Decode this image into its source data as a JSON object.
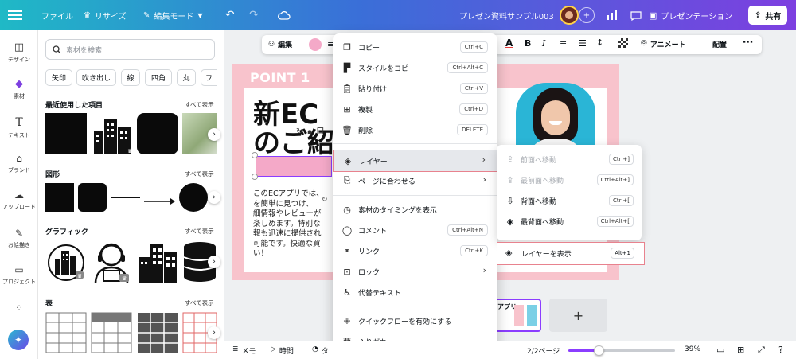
{
  "topbar": {
    "file": "ファイル",
    "resize": "リサイズ",
    "edit_mode": "編集モード",
    "doc_title": "プレゼン資料サンプル003",
    "present": "プレゼンテーション",
    "share": "共有"
  },
  "leftnav": [
    "デザイン",
    "素材",
    "テキスト",
    "ブランド",
    "アップロード",
    "お絵描き",
    "プロジェクト"
  ],
  "panel": {
    "search_placeholder": "素材を検索",
    "chips": [
      "矢印",
      "吹き出し",
      "線",
      "四角",
      "丸",
      "フ"
    ],
    "sections": [
      {
        "title": "最近使用した項目",
        "link": "すべて表示"
      },
      {
        "title": "図形",
        "link": "すべて表示"
      },
      {
        "title": "グラフィック",
        "link": "すべて表示"
      },
      {
        "title": "表",
        "link": "すべて表示"
      }
    ]
  },
  "toolbar": {
    "edit": "編集",
    "animate": "アニメート",
    "position": "配置"
  },
  "slide": {
    "point": "POINT 1",
    "heading_line1": "新EC",
    "heading_line2": "のご紹",
    "body": [
      "このECアプリでは、",
      "を簡単に見つけ、",
      "細情報やレビューが",
      "楽しめます。特別な",
      "報も迅速に提供され",
      "可能です。快適な買",
      "い！"
    ]
  },
  "context_menu": {
    "items": [
      {
        "label": "コピー",
        "shortcut": "Ctrl+C"
      },
      {
        "label": "スタイルをコピー",
        "shortcut": "Ctrl+Alt+C"
      },
      {
        "label": "貼り付け",
        "shortcut": "Ctrl+V"
      },
      {
        "label": "複製",
        "shortcut": "Ctrl+D"
      },
      {
        "label": "削除",
        "shortcut": "DELETE"
      },
      {
        "label": "レイヤー",
        "shortcut": ""
      },
      {
        "label": "ページに合わせる",
        "shortcut": ""
      },
      {
        "label": "素材のタイミングを表示",
        "shortcut": ""
      },
      {
        "label": "コメント",
        "shortcut": "Ctrl+Alt+N"
      },
      {
        "label": "リンク",
        "shortcut": "Ctrl+K"
      },
      {
        "label": "ロック",
        "shortcut": ""
      },
      {
        "label": "代替テキスト",
        "shortcut": ""
      },
      {
        "label": "クイックフローを有効にする",
        "shortcut": ""
      },
      {
        "label": "ふりがな",
        "shortcut": ""
      }
    ]
  },
  "layer_submenu": {
    "items": [
      {
        "label": "前面へ移動",
        "shortcut": "Ctrl+]"
      },
      {
        "label": "最前面へ移動",
        "shortcut": "Ctrl+Alt+]"
      },
      {
        "label": "背面へ移動",
        "shortcut": "Ctrl+["
      },
      {
        "label": "最背面へ移動",
        "shortcut": "Ctrl+Alt+["
      },
      {
        "label": "レイヤーを表示",
        "shortcut": "Alt+1"
      }
    ]
  },
  "thumbnail_strip": {
    "add": "+",
    "thumb_text": "アプリ"
  },
  "bottombar": {
    "memo": "メモ",
    "time": "時間",
    "timer": "タ",
    "pages": "2/2ページ",
    "zoom": "39%",
    "zoom_level": 0.28
  },
  "colors": {
    "accent": "#8b3dff",
    "pink": "#f8c3cc",
    "highlight": "#e8828e"
  }
}
